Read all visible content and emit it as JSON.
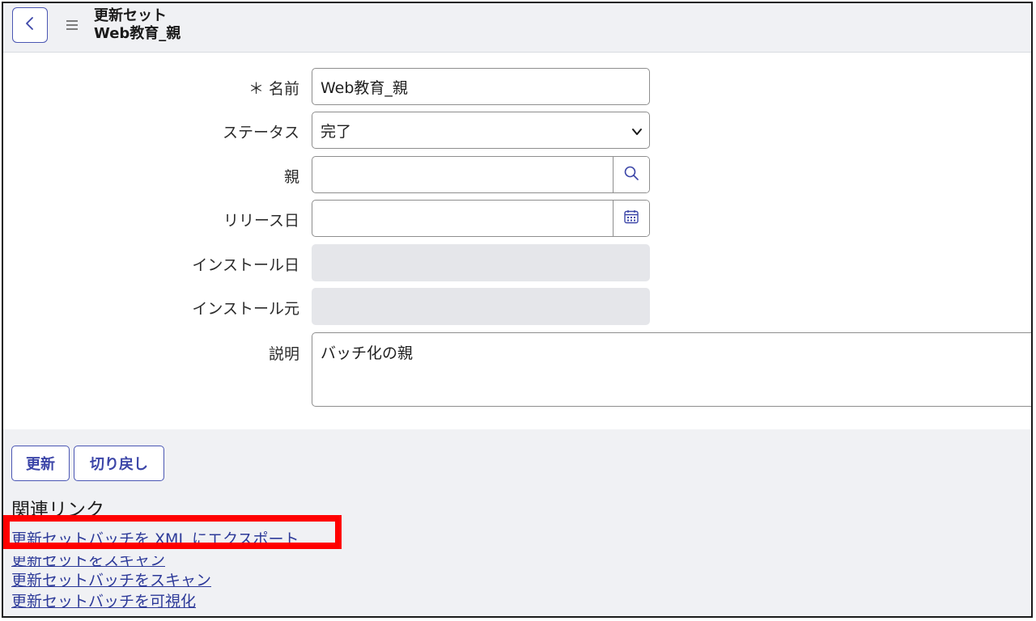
{
  "header": {
    "title_line1": "更新セット",
    "title_line2": "Web教育_親"
  },
  "form": {
    "name_label": "＊ 名前",
    "name_value": "Web教育_親",
    "status_label": "ステータス",
    "status_value": "完了",
    "parent_label": "親",
    "parent_value": "",
    "release_date_label": "リリース日",
    "release_date_value": "",
    "install_date_label": "インストール日",
    "install_date_value": "",
    "install_source_label": "インストール元",
    "install_source_value": "",
    "description_label": "説明",
    "description_value": "バッチ化の親"
  },
  "actions": {
    "update_label": "更新",
    "revert_label": "切り戻し"
  },
  "related_links": {
    "title": "関連リンク",
    "items": [
      "更新セットバッチを XML にエクスポート",
      "更新セットをスキャン",
      "更新セットバッチをスキャン",
      "更新セットバッチを可視化"
    ]
  },
  "colors": {
    "accent": "#4a56b3",
    "link": "#2d3a99",
    "highlight": "#ff0000",
    "header_bg": "#f0f1f4",
    "readonly_bg": "#e5e6ea"
  }
}
